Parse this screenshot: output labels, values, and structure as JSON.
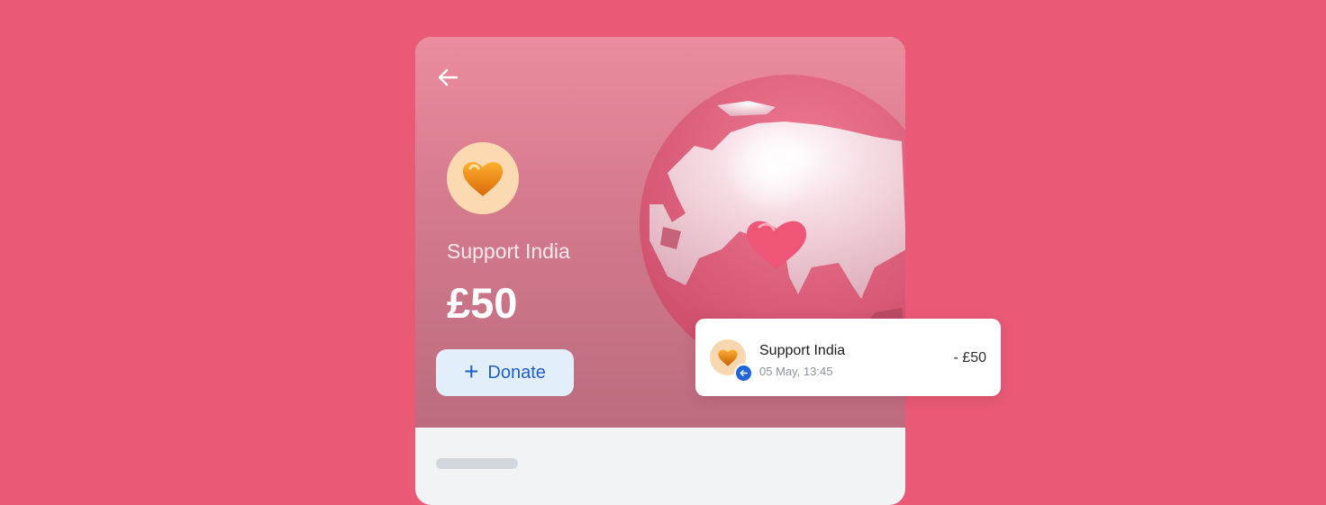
{
  "colors": {
    "background": "#ea5a77",
    "accent": "#1f5fc8",
    "donate_bg": "#e3eefb",
    "avatar_bg": "#fbd9b1"
  },
  "icons": {
    "back": "arrow-left-icon",
    "avatar": "heart-icon",
    "donate": "plus-icon",
    "badge": "arrow-left-icon"
  },
  "hero": {
    "title": "Support India",
    "amount": "£50",
    "donate_label": "Donate"
  },
  "transaction": {
    "name": "Support India",
    "date": "05 May, 13:45",
    "amount": "- £50"
  }
}
